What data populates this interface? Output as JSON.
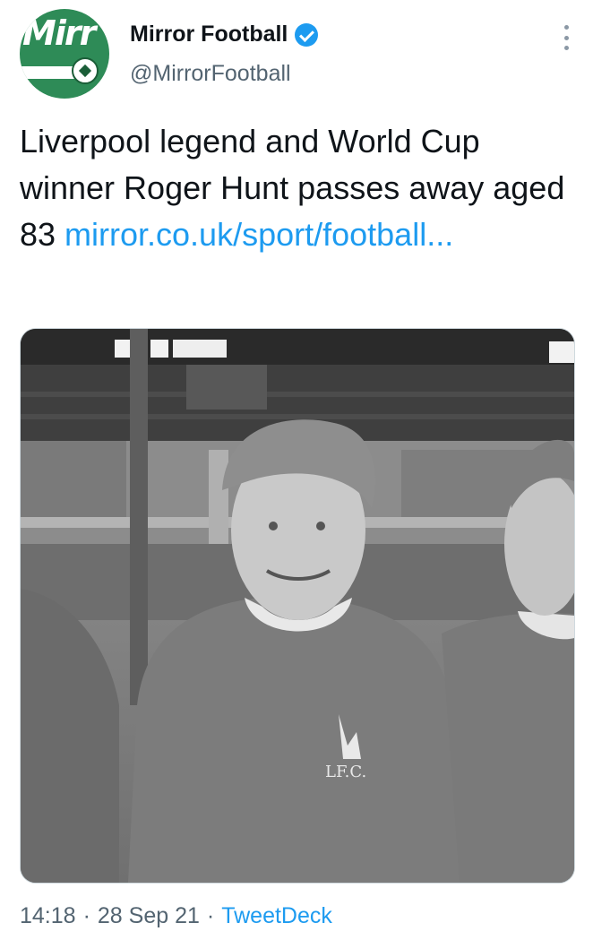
{
  "tweet": {
    "display_name": "Mirror Football",
    "handle": "@MirrorFootball",
    "verified": true,
    "avatar_icon": "mirror-football-logo",
    "avatar_color": "#2e8b57",
    "text": "Liverpool legend and World Cup winner Roger Hunt passes away aged 83 ",
    "link_text": "mirror.co.uk/sport/football...",
    "link_color": "#1d9bf0",
    "media_alt": "black-and-white photo of footballers",
    "time": "14:18",
    "date": "28 Sep 21",
    "separator": "·",
    "source": "TweetDeck"
  }
}
